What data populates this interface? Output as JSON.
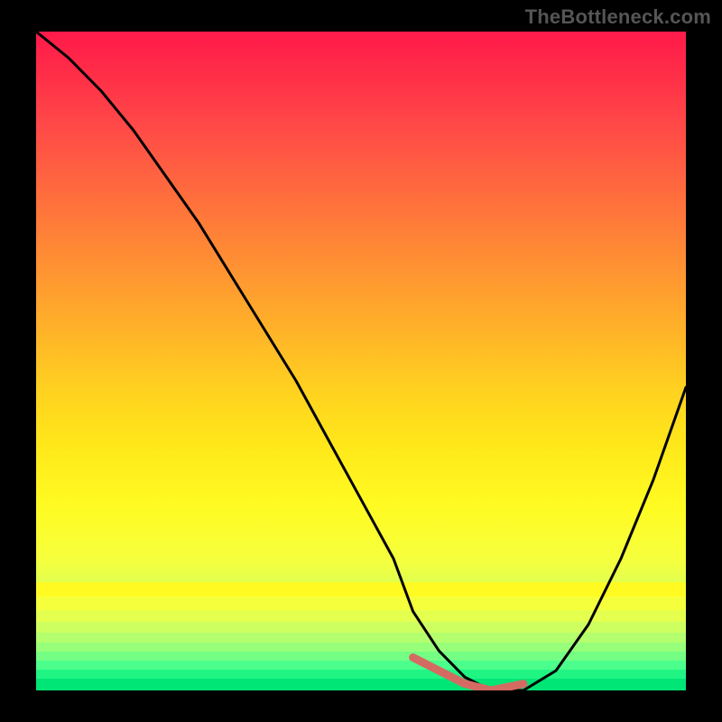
{
  "watermark": "TheBottleneck.com",
  "colors": {
    "frame_bg": "#000000",
    "line": "#000000",
    "marker": "#d46b63",
    "gradient_top": "#ff1a4a",
    "gradient_bottom": "#00e676"
  },
  "chart_data": {
    "type": "line",
    "title": "",
    "xlabel": "",
    "ylabel": "",
    "xlim": [
      0,
      100
    ],
    "ylim": [
      0,
      100
    ],
    "x": [
      0,
      5,
      10,
      15,
      20,
      25,
      30,
      35,
      40,
      45,
      50,
      55,
      58,
      62,
      66,
      70,
      75,
      80,
      85,
      90,
      95,
      100
    ],
    "values": [
      100,
      96,
      91,
      85,
      78,
      71,
      63,
      55,
      47,
      38,
      29,
      20,
      12,
      6,
      2,
      0,
      0,
      3,
      10,
      20,
      32,
      46
    ],
    "marker_segment": {
      "x": [
        58,
        62,
        66,
        70,
        75
      ],
      "values": [
        5,
        3,
        1,
        0,
        1
      ]
    },
    "annotations": [],
    "legend": [],
    "grid": false
  }
}
